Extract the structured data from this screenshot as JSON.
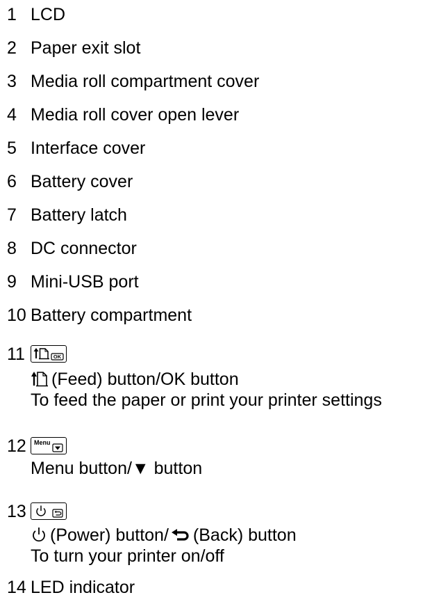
{
  "items": [
    {
      "number": "1",
      "label": "LCD"
    },
    {
      "number": "2",
      "label": "Paper exit slot"
    },
    {
      "number": "3",
      "label": "Media roll compartment cover"
    },
    {
      "number": "4",
      "label": "Media roll cover open lever"
    },
    {
      "number": "5",
      "label": "Interface cover"
    },
    {
      "number": "6",
      "label": "Battery cover"
    },
    {
      "number": "7",
      "label": "Battery latch"
    },
    {
      "number": "8",
      "label": "DC connector"
    },
    {
      "number": "9",
      "label": "Mini-USB port"
    },
    {
      "number": "10",
      "label": "Battery compartment"
    }
  ],
  "buttons": {
    "feed": {
      "number": "11",
      "icon_name": "feed-ok-button-icon",
      "key_text": "OK",
      "title": "(Feed) button/OK button",
      "description": "To feed the paper or print your printer settings"
    },
    "menu": {
      "number": "12",
      "icon_name": "menu-down-button-icon",
      "key_text": "Menu",
      "title": "Menu button/▼ button"
    },
    "power": {
      "number": "13",
      "icon_name": "power-back-button-icon",
      "title_power": "(Power) button/",
      "title_back": "(Back) button",
      "description": "To turn your printer on/off"
    }
  },
  "led": {
    "number": "14",
    "label": "LED indicator"
  }
}
